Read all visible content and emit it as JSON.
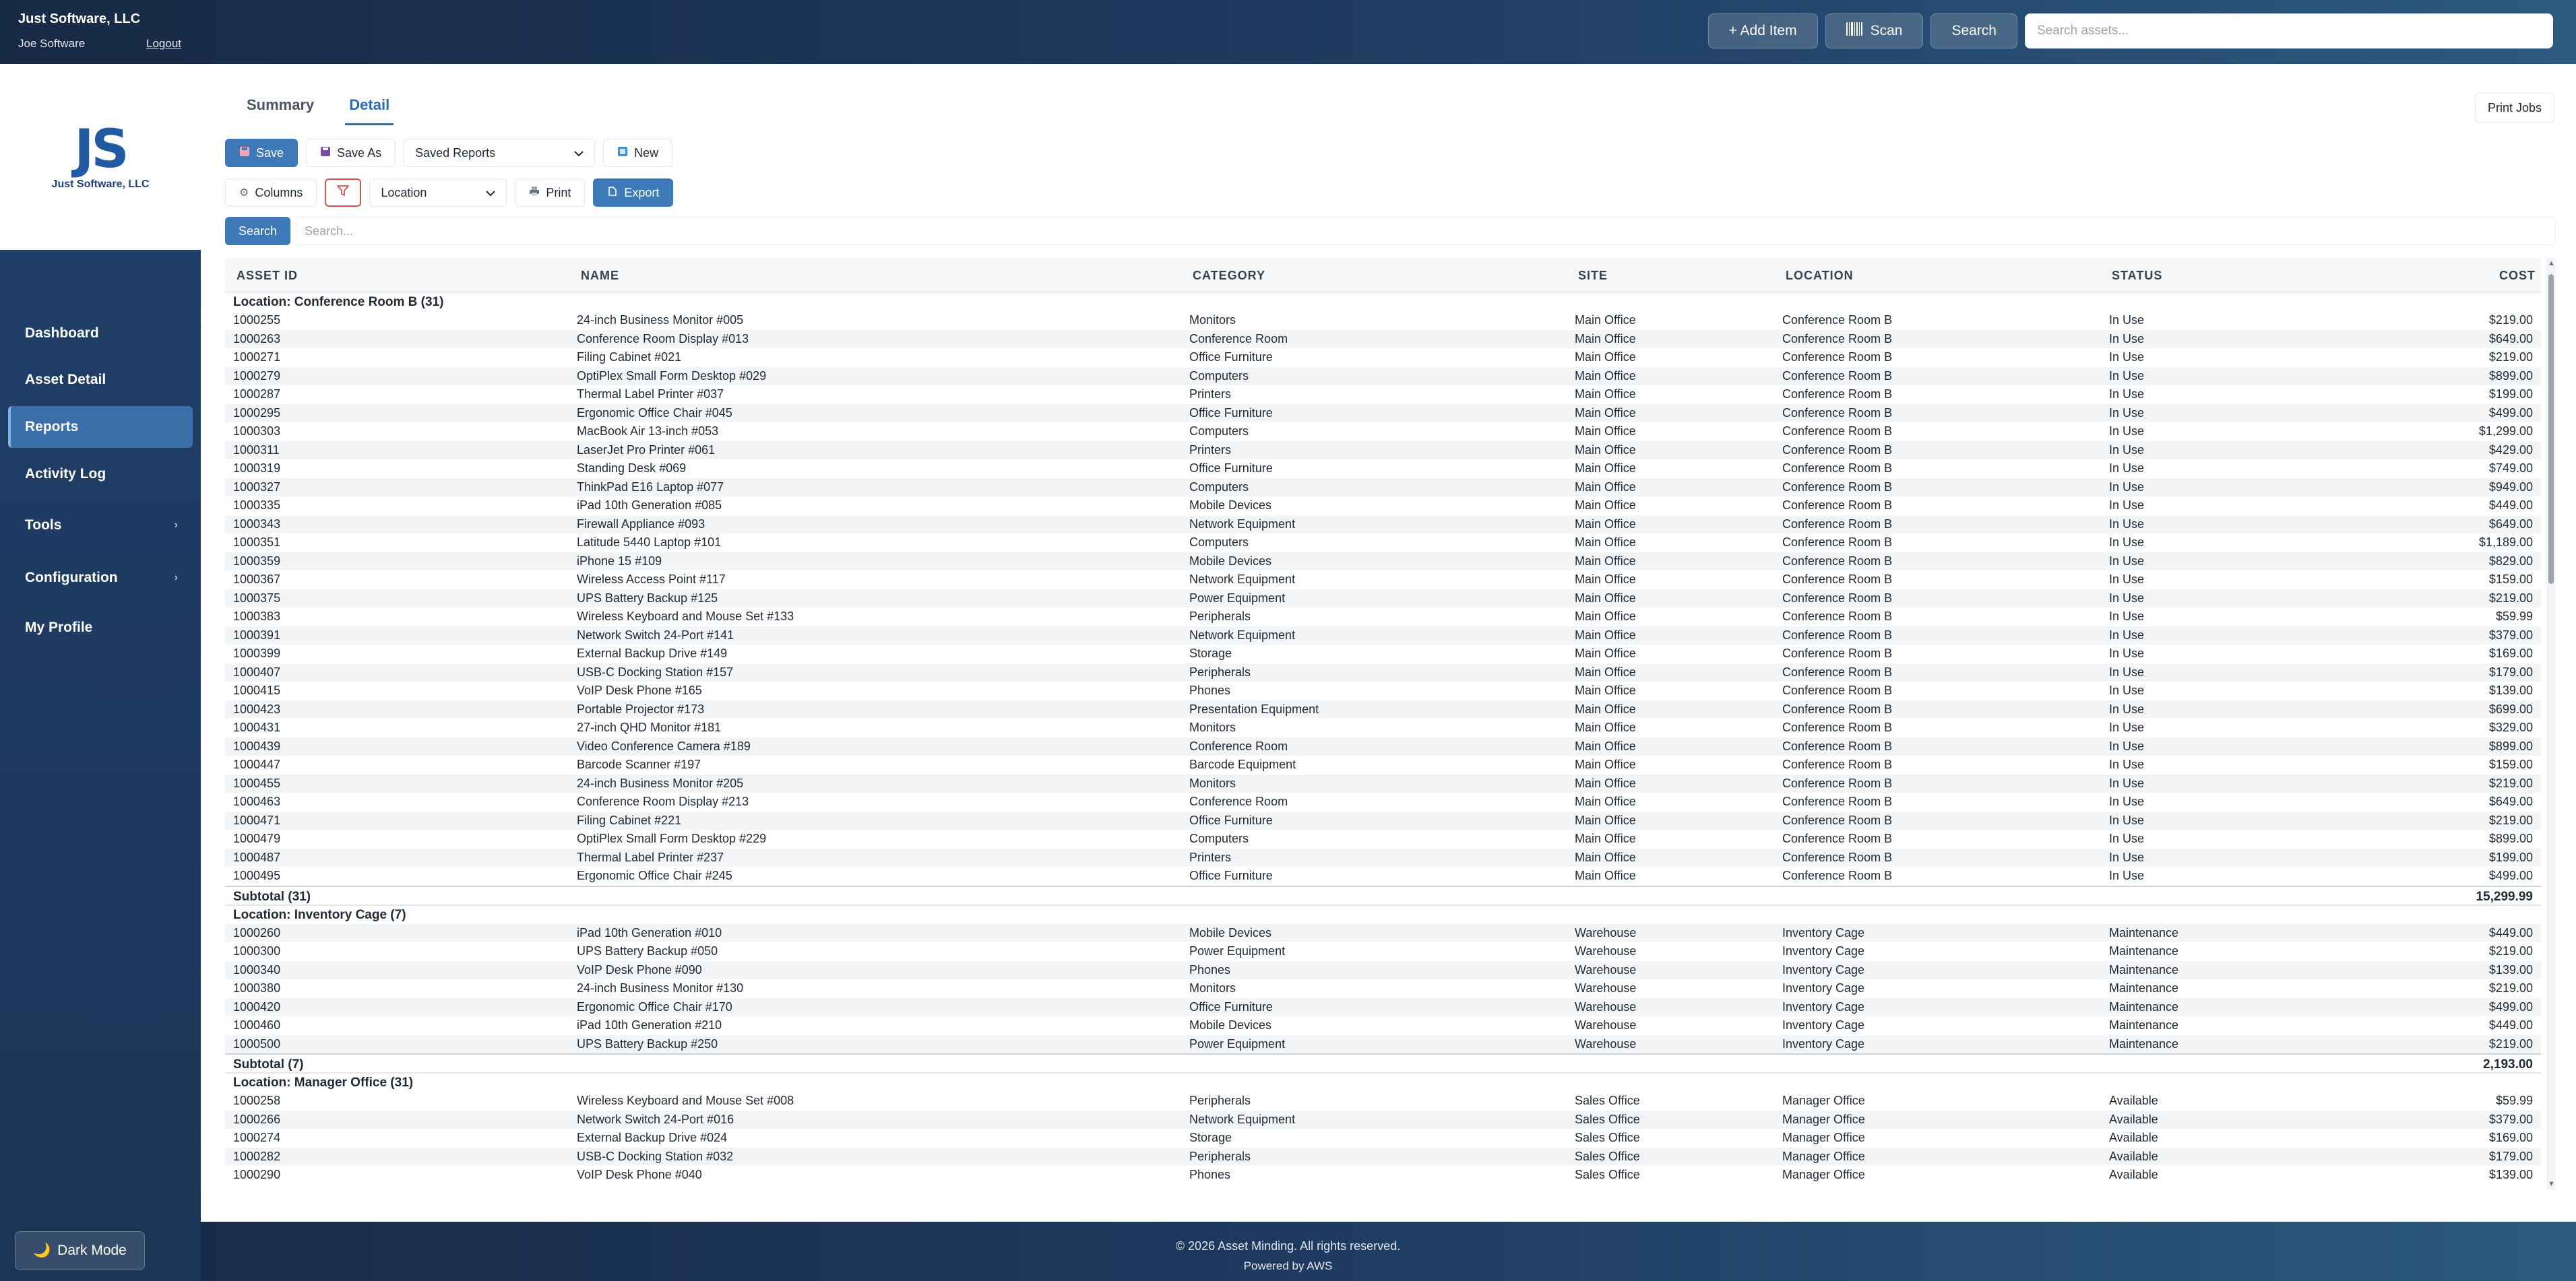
{
  "header": {
    "company": "Just Software, LLC",
    "user": "Joe Software",
    "logout": "Logout",
    "add_item": "+ Add Item",
    "scan": "Scan",
    "search_btn": "Search",
    "search_placeholder": "Search assets..."
  },
  "sidebar": {
    "logo_mark": "JS",
    "logo_text": "Just Software, LLC",
    "items": [
      {
        "label": "Dashboard"
      },
      {
        "label": "Asset Detail"
      },
      {
        "label": "Reports"
      },
      {
        "label": "Activity Log"
      },
      {
        "label": "Tools"
      },
      {
        "label": "Configuration"
      },
      {
        "label": "My Profile"
      }
    ],
    "dark_mode": "Dark Mode"
  },
  "main": {
    "tabs": [
      "Summary",
      "Detail"
    ],
    "print_jobs": "Print Jobs",
    "save": "Save",
    "save_as": "Save As",
    "saved_reports": "Saved Reports",
    "new": "New",
    "columns": "Columns",
    "group_by": "Location",
    "print": "Print",
    "export": "Export",
    "search_btn": "Search",
    "search_placeholder": "Search..."
  },
  "table": {
    "headers": [
      "ASSET ID",
      "NAME",
      "CATEGORY",
      "SITE",
      "LOCATION",
      "STATUS",
      "COST"
    ],
    "groups": [
      {
        "title": "Location: Conference Room B (31)",
        "subtotal_label": "Subtotal (31)",
        "subtotal": "15,299.99",
        "rows": [
          [
            "1000255",
            "24-inch Business Monitor #005",
            "Monitors",
            "Main Office",
            "Conference Room B",
            "In Use",
            "$219.00"
          ],
          [
            "1000263",
            "Conference Room Display #013",
            "Conference Room",
            "Main Office",
            "Conference Room B",
            "In Use",
            "$649.00"
          ],
          [
            "1000271",
            "Filing Cabinet #021",
            "Office Furniture",
            "Main Office",
            "Conference Room B",
            "In Use",
            "$219.00"
          ],
          [
            "1000279",
            "OptiPlex Small Form Desktop #029",
            "Computers",
            "Main Office",
            "Conference Room B",
            "In Use",
            "$899.00"
          ],
          [
            "1000287",
            "Thermal Label Printer #037",
            "Printers",
            "Main Office",
            "Conference Room B",
            "In Use",
            "$199.00"
          ],
          [
            "1000295",
            "Ergonomic Office Chair #045",
            "Office Furniture",
            "Main Office",
            "Conference Room B",
            "In Use",
            "$499.00"
          ],
          [
            "1000303",
            "MacBook Air 13-inch #053",
            "Computers",
            "Main Office",
            "Conference Room B",
            "In Use",
            "$1,299.00"
          ],
          [
            "1000311",
            "LaserJet Pro Printer #061",
            "Printers",
            "Main Office",
            "Conference Room B",
            "In Use",
            "$429.00"
          ],
          [
            "1000319",
            "Standing Desk #069",
            "Office Furniture",
            "Main Office",
            "Conference Room B",
            "In Use",
            "$749.00"
          ],
          [
            "1000327",
            "ThinkPad E16 Laptop #077",
            "Computers",
            "Main Office",
            "Conference Room B",
            "In Use",
            "$949.00"
          ],
          [
            "1000335",
            "iPad 10th Generation #085",
            "Mobile Devices",
            "Main Office",
            "Conference Room B",
            "In Use",
            "$449.00"
          ],
          [
            "1000343",
            "Firewall Appliance #093",
            "Network Equipment",
            "Main Office",
            "Conference Room B",
            "In Use",
            "$649.00"
          ],
          [
            "1000351",
            "Latitude 5440 Laptop #101",
            "Computers",
            "Main Office",
            "Conference Room B",
            "In Use",
            "$1,189.00"
          ],
          [
            "1000359",
            "iPhone 15 #109",
            "Mobile Devices",
            "Main Office",
            "Conference Room B",
            "In Use",
            "$829.00"
          ],
          [
            "1000367",
            "Wireless Access Point #117",
            "Network Equipment",
            "Main Office",
            "Conference Room B",
            "In Use",
            "$159.00"
          ],
          [
            "1000375",
            "UPS Battery Backup #125",
            "Power Equipment",
            "Main Office",
            "Conference Room B",
            "In Use",
            "$219.00"
          ],
          [
            "1000383",
            "Wireless Keyboard and Mouse Set #133",
            "Peripherals",
            "Main Office",
            "Conference Room B",
            "In Use",
            "$59.99"
          ],
          [
            "1000391",
            "Network Switch 24-Port #141",
            "Network Equipment",
            "Main Office",
            "Conference Room B",
            "In Use",
            "$379.00"
          ],
          [
            "1000399",
            "External Backup Drive #149",
            "Storage",
            "Main Office",
            "Conference Room B",
            "In Use",
            "$169.00"
          ],
          [
            "1000407",
            "USB-C Docking Station #157",
            "Peripherals",
            "Main Office",
            "Conference Room B",
            "In Use",
            "$179.00"
          ],
          [
            "1000415",
            "VoIP Desk Phone #165",
            "Phones",
            "Main Office",
            "Conference Room B",
            "In Use",
            "$139.00"
          ],
          [
            "1000423",
            "Portable Projector #173",
            "Presentation Equipment",
            "Main Office",
            "Conference Room B",
            "In Use",
            "$699.00"
          ],
          [
            "1000431",
            "27-inch QHD Monitor #181",
            "Monitors",
            "Main Office",
            "Conference Room B",
            "In Use",
            "$329.00"
          ],
          [
            "1000439",
            "Video Conference Camera #189",
            "Conference Room",
            "Main Office",
            "Conference Room B",
            "In Use",
            "$899.00"
          ],
          [
            "1000447",
            "Barcode Scanner #197",
            "Barcode Equipment",
            "Main Office",
            "Conference Room B",
            "In Use",
            "$159.00"
          ],
          [
            "1000455",
            "24-inch Business Monitor #205",
            "Monitors",
            "Main Office",
            "Conference Room B",
            "In Use",
            "$219.00"
          ],
          [
            "1000463",
            "Conference Room Display #213",
            "Conference Room",
            "Main Office",
            "Conference Room B",
            "In Use",
            "$649.00"
          ],
          [
            "1000471",
            "Filing Cabinet #221",
            "Office Furniture",
            "Main Office",
            "Conference Room B",
            "In Use",
            "$219.00"
          ],
          [
            "1000479",
            "OptiPlex Small Form Desktop #229",
            "Computers",
            "Main Office",
            "Conference Room B",
            "In Use",
            "$899.00"
          ],
          [
            "1000487",
            "Thermal Label Printer #237",
            "Printers",
            "Main Office",
            "Conference Room B",
            "In Use",
            "$199.00"
          ],
          [
            "1000495",
            "Ergonomic Office Chair #245",
            "Office Furniture",
            "Main Office",
            "Conference Room B",
            "In Use",
            "$499.00"
          ]
        ]
      },
      {
        "title": "Location: Inventory Cage (7)",
        "subtotal_label": "Subtotal (7)",
        "subtotal": "2,193.00",
        "rows": [
          [
            "1000260",
            "iPad 10th Generation #010",
            "Mobile Devices",
            "Warehouse",
            "Inventory Cage",
            "Maintenance",
            "$449.00"
          ],
          [
            "1000300",
            "UPS Battery Backup #050",
            "Power Equipment",
            "Warehouse",
            "Inventory Cage",
            "Maintenance",
            "$219.00"
          ],
          [
            "1000340",
            "VoIP Desk Phone #090",
            "Phones",
            "Warehouse",
            "Inventory Cage",
            "Maintenance",
            "$139.00"
          ],
          [
            "1000380",
            "24-inch Business Monitor #130",
            "Monitors",
            "Warehouse",
            "Inventory Cage",
            "Maintenance",
            "$219.00"
          ],
          [
            "1000420",
            "Ergonomic Office Chair #170",
            "Office Furniture",
            "Warehouse",
            "Inventory Cage",
            "Maintenance",
            "$499.00"
          ],
          [
            "1000460",
            "iPad 10th Generation #210",
            "Mobile Devices",
            "Warehouse",
            "Inventory Cage",
            "Maintenance",
            "$449.00"
          ],
          [
            "1000500",
            "UPS Battery Backup #250",
            "Power Equipment",
            "Warehouse",
            "Inventory Cage",
            "Maintenance",
            "$219.00"
          ]
        ]
      },
      {
        "title": "Location: Manager Office (31)",
        "rows": [
          [
            "1000258",
            "Wireless Keyboard and Mouse Set #008",
            "Peripherals",
            "Sales Office",
            "Manager Office",
            "Available",
            "$59.99"
          ],
          [
            "1000266",
            "Network Switch 24-Port #016",
            "Network Equipment",
            "Sales Office",
            "Manager Office",
            "Available",
            "$379.00"
          ],
          [
            "1000274",
            "External Backup Drive #024",
            "Storage",
            "Sales Office",
            "Manager Office",
            "Available",
            "$169.00"
          ],
          [
            "1000282",
            "USB-C Docking Station #032",
            "Peripherals",
            "Sales Office",
            "Manager Office",
            "Available",
            "$179.00"
          ],
          [
            "1000290",
            "VoIP Desk Phone #040",
            "Phones",
            "Sales Office",
            "Manager Office",
            "Available",
            "$139.00"
          ]
        ]
      }
    ]
  },
  "footer": {
    "copyright": "© 2026 Asset Minding. All rights reserved.",
    "powered": "Powered by AWS"
  }
}
